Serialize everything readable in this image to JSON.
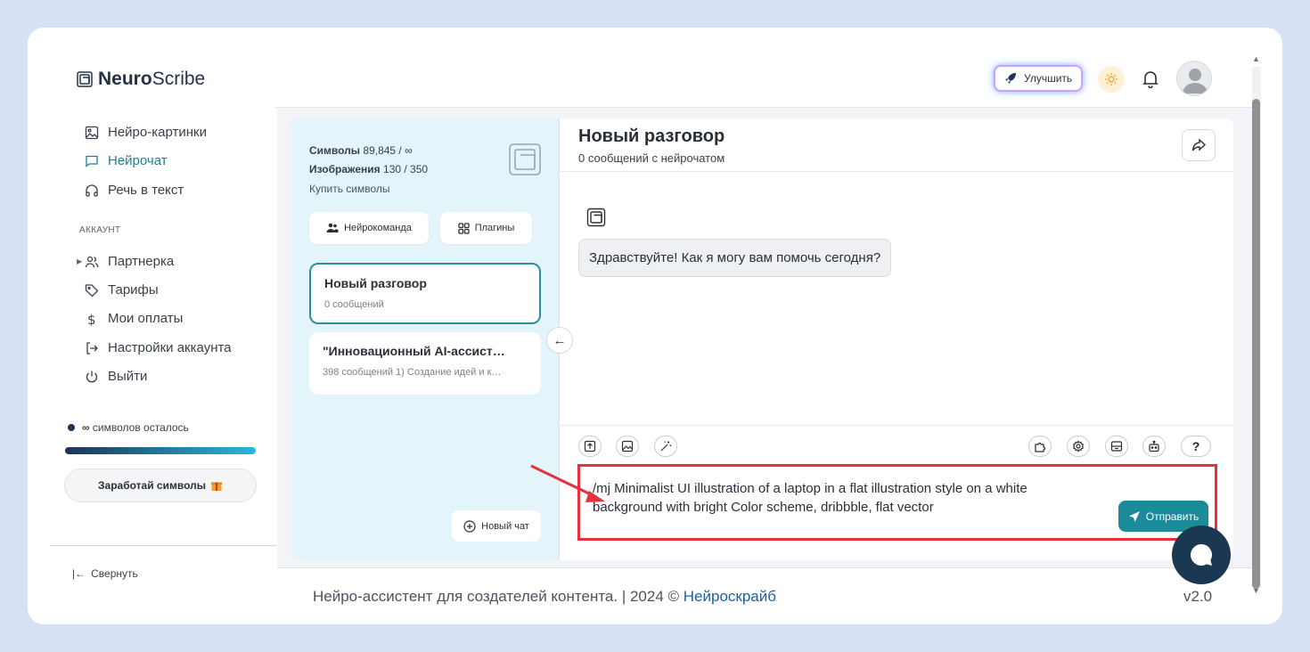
{
  "app": {
    "logo_bold": "Neuro",
    "logo_rest": "Scribe",
    "upgrade_label": "Улучшить"
  },
  "sidebar": {
    "items_top": [
      {
        "label": "Нейро-картинки",
        "icon": "image-icon"
      },
      {
        "label": "Нейрочат",
        "icon": "chat-icon",
        "active": true
      },
      {
        "label": "Речь в текст",
        "icon": "headphones-icon"
      }
    ],
    "section_account": "АККАУНТ",
    "items_account": [
      {
        "label": "Партнерка",
        "icon": "users-icon"
      },
      {
        "label": "Тарифы",
        "icon": "tag-icon"
      },
      {
        "label": "Мои оплаты",
        "icon": "dollar-icon"
      },
      {
        "label": "Настройки аккаунта",
        "icon": "login-icon"
      },
      {
        "label": "Выйти",
        "icon": "power-icon"
      }
    ],
    "symbols_infinity": "∞",
    "symbols_left": "символов осталось",
    "earn_label": "Заработай символы",
    "collapse_label": "Свернуть"
  },
  "chat_list": {
    "symbols_label": "Символы",
    "symbols_value": "89,845 / ∞",
    "images_label": "Изображения",
    "images_value": "130 / 350",
    "buy_label": "Купить символы",
    "team_label": "Нейрокоманда",
    "plugins_label": "Плагины",
    "chats": [
      {
        "title": "Новый разговор",
        "subtitle": "0 сообщений"
      },
      {
        "title": "\"Инновационный AI-ассист…",
        "subtitle": "398 сообщений 1) Создание идей и к…"
      }
    ],
    "new_chat_label": "Новый чат"
  },
  "chat": {
    "title": "Новый разговор",
    "subtitle": "0 сообщений с нейрочатом",
    "greeting": "Здравствуйте! Как я могу вам помочь сегодня?",
    "prompt_value": "/mj Minimalist UI illustration of a laptop in a flat illustration style on a white background with bright Color scheme, dribbble, flat vector",
    "send_label": "Отправить",
    "help_tool": "?"
  },
  "footer": {
    "text": "Нейро-ассистент для создателей контента.  | 2024 © ",
    "link": "Нейроскрайб",
    "version": "v2.0"
  },
  "colors": {
    "accent": "#1b8b99",
    "highlight": "#e5323f",
    "panel": "#e4f4fb"
  }
}
